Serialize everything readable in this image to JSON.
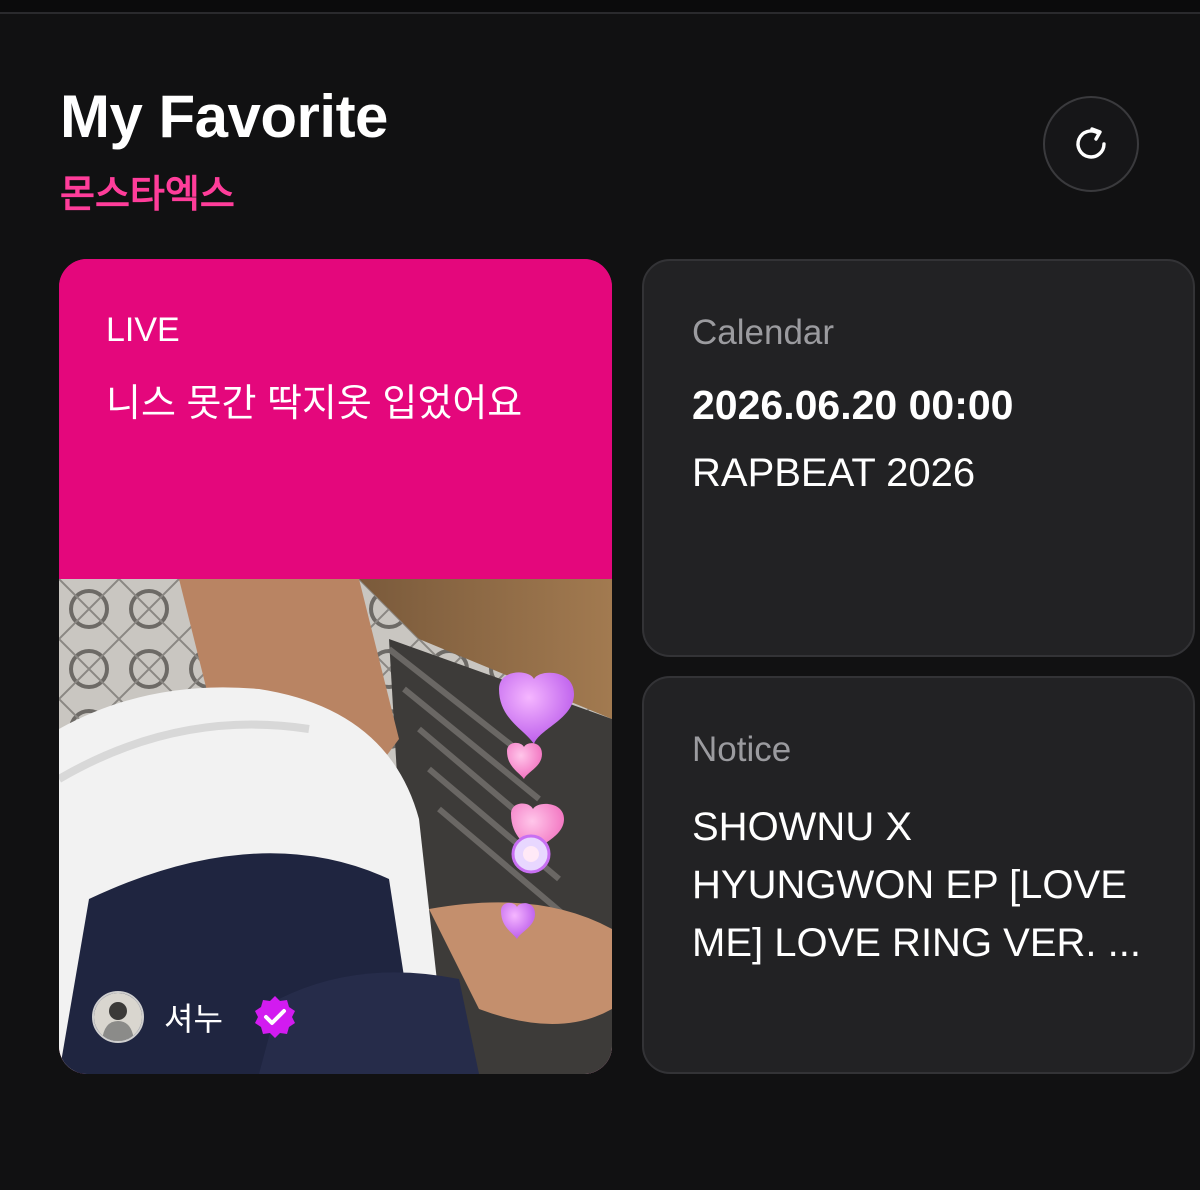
{
  "header": {
    "title": "My Favorite",
    "subtitle": "몬스타엑스",
    "refresh_icon": "refresh-icon"
  },
  "live": {
    "label": "LIVE",
    "title": "니스 못간 딱지옷 입었어요",
    "user_name": "셔누",
    "verified_icon": "verified-badge-icon",
    "accent": "#e4077c"
  },
  "calendar": {
    "label": "Calendar",
    "date": "2026.06.20 00:00",
    "event": "RAPBEAT 2026"
  },
  "notice": {
    "label": "Notice",
    "text": "SHOWNU X HYUNGWON EP [LOVE ME] LOVE RING VER. ..."
  },
  "colors": {
    "background": "#111112",
    "subtitle": "#ff3d9a",
    "card": "#222224",
    "muted": "#9b9b9f"
  }
}
